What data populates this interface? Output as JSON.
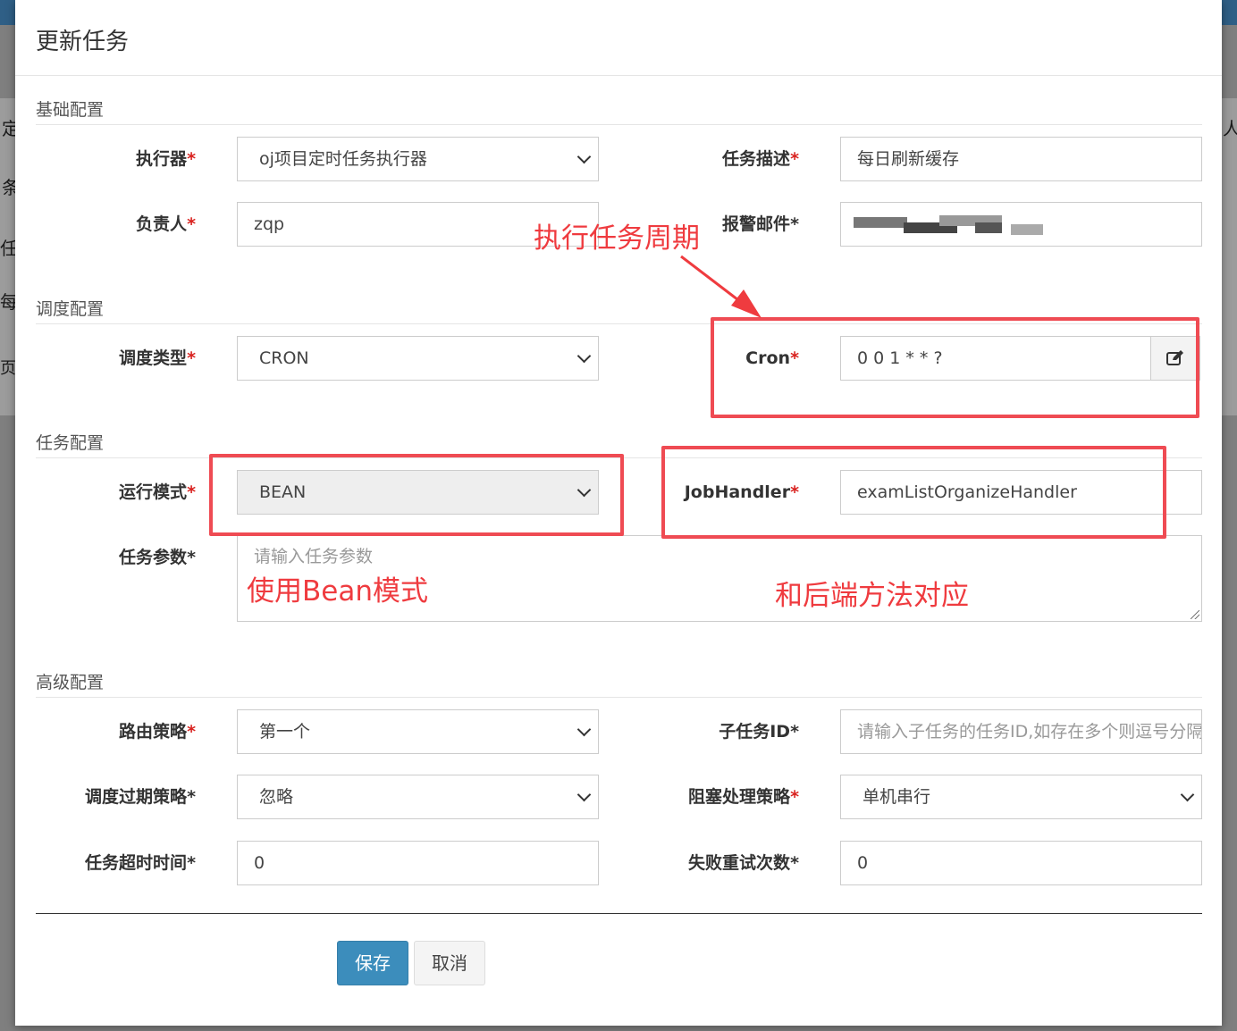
{
  "background": {
    "fragments": [
      "定",
      "条",
      "任",
      "每",
      "页，",
      "人"
    ]
  },
  "modal": {
    "title": "更新任务"
  },
  "sections": {
    "basic": "基础配置",
    "schedule": "调度配置",
    "task": "任务配置",
    "advanced": "高级配置"
  },
  "fields": {
    "executor": {
      "label": "执行器",
      "value": "oj项目定时任务执行器"
    },
    "task_desc": {
      "label": "任务描述",
      "value": "每日刷新缓存"
    },
    "owner": {
      "label": "负责人",
      "value": "zqp"
    },
    "alarm_email": {
      "label": "报警邮件"
    },
    "schedule_type": {
      "label": "调度类型",
      "value": "CRON"
    },
    "cron": {
      "label": "Cron",
      "value": "0 0 1 * * ?"
    },
    "run_mode": {
      "label": "运行模式",
      "value": "BEAN"
    },
    "job_handler": {
      "label": "JobHandler",
      "value": "examListOrganizeHandler"
    },
    "task_param": {
      "label": "任务参数",
      "placeholder": "请输入任务参数"
    },
    "route_strategy": {
      "label": "路由策略",
      "value": "第一个"
    },
    "child_job_id": {
      "label": "子任务ID",
      "placeholder": "请输入子任务的任务ID,如存在多个则逗号分隔"
    },
    "misfire_strategy": {
      "label": "调度过期策略",
      "value": "忽略"
    },
    "block_strategy": {
      "label": "阻塞处理策略",
      "value": "单机串行"
    },
    "timeout": {
      "label": "任务超时时间",
      "value": "0"
    },
    "retry_count": {
      "label": "失败重试次数",
      "value": "0"
    }
  },
  "buttons": {
    "save": "保存",
    "cancel": "取消"
  },
  "annotations": {
    "cron_note": "执行任务周期",
    "bean_note": "使用Bean模式",
    "handler_note": "和后端方法对应"
  },
  "colors": {
    "annotation_red": "#ef4b53",
    "primary_button": "#3c8dbc",
    "required_star": "#d9221f"
  },
  "icons": {
    "cron_edit": "edit-icon"
  }
}
